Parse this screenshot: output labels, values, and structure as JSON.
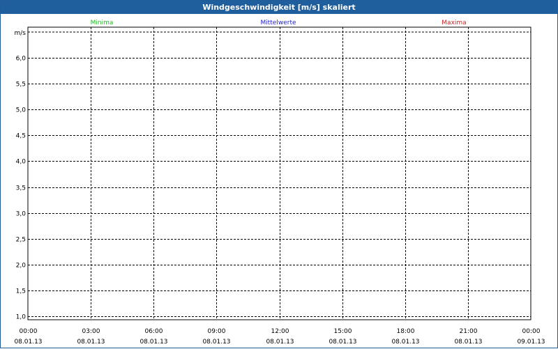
{
  "window": {
    "title": "Windgeschwindigkeit [m/s] skaliert"
  },
  "chart_data": {
    "type": "line",
    "title": "Windgeschwindigkeit [m/s] skaliert",
    "ylabel": "m/s",
    "xlabel": "",
    "ylim": [
      0.95,
      6.5
    ],
    "y_ticks": [
      "1,0",
      "1,5",
      "2,0",
      "2,5",
      "3,0",
      "3,5",
      "4,0",
      "4,5",
      "5,0",
      "5,5",
      "6,0"
    ],
    "y_tick_values": [
      1.0,
      1.5,
      2.0,
      2.5,
      3.0,
      3.5,
      4.0,
      4.5,
      5.0,
      5.5,
      6.0
    ],
    "x_ticks": [
      {
        "time": "00:00",
        "date": "08.01.13"
      },
      {
        "time": "03:00",
        "date": "08.01.13"
      },
      {
        "time": "06:00",
        "date": "08.01.13"
      },
      {
        "time": "09:00",
        "date": "08.01.13"
      },
      {
        "time": "12:00",
        "date": "08.01.13"
      },
      {
        "time": "15:00",
        "date": "08.01.13"
      },
      {
        "time": "18:00",
        "date": "08.01.13"
      },
      {
        "time": "21:00",
        "date": "08.01.13"
      },
      {
        "time": "00:00",
        "date": "09.01.13"
      }
    ],
    "grid": true,
    "legend_position": "top",
    "series": [
      {
        "name": "Minima",
        "color": "#22bb22",
        "values": []
      },
      {
        "name": "Mittelwerte",
        "color": "#2222cc",
        "values": []
      },
      {
        "name": "Maxima",
        "color": "#cc2222",
        "values": []
      }
    ]
  }
}
